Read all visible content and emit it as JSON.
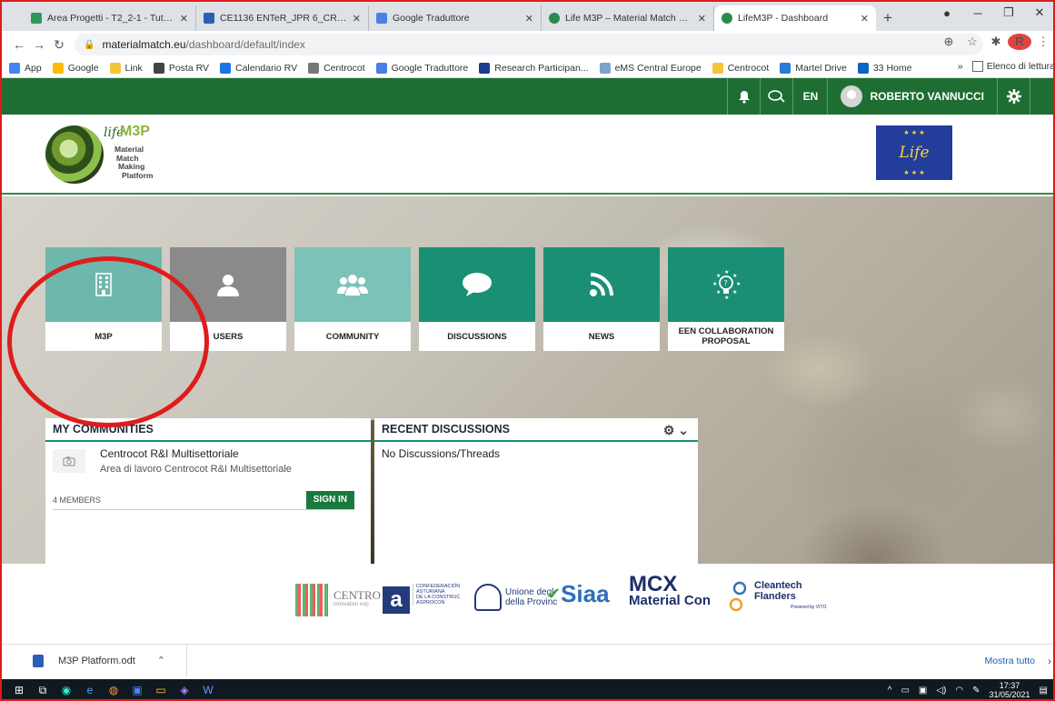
{
  "browser": {
    "tabs": [
      {
        "title": "Area Progetti - T2_2-1 - Tutti i do",
        "color": "#2f9a58"
      },
      {
        "title": "CE1136 ENTeR_JPR 6_CR1-Ver2.d",
        "color": "#2b5fb5"
      },
      {
        "title": "Google Traduttore",
        "color": "#4a7fe6"
      },
      {
        "title": "Life M3P – Material Match Makin",
        "color": "#2a8a4a"
      },
      {
        "title": "LifeM3P - Dashboard",
        "color": "#2a8a4a"
      }
    ],
    "new_tab": "+",
    "url_host": "materialmatch.eu",
    "url_path": "/dashboard/default/index",
    "profile_initial": "R",
    "bookmarks": [
      {
        "label": "App",
        "color": "#4285f4"
      },
      {
        "label": "Google",
        "color": "#fbbc05"
      },
      {
        "label": "Link",
        "color": "#f3c53a"
      },
      {
        "label": "Posta RV",
        "color": "#444444"
      },
      {
        "label": "Calendario RV",
        "color": "#1a73e8"
      },
      {
        "label": "Centrocot",
        "color": "#777777"
      },
      {
        "label": "Google Traduttore",
        "color": "#4a7fe6"
      },
      {
        "label": "Research Participan...",
        "color": "#1a3d8f"
      },
      {
        "label": "eMS Central Europe",
        "color": "#7fa3c7"
      },
      {
        "label": "Centrocot",
        "color": "#f3c53a"
      },
      {
        "label": "Martel Drive",
        "color": "#2a7bd3"
      },
      {
        "label": "33 Home",
        "color": "#0a66c2"
      }
    ],
    "reading_list": "Elenco di lettura",
    "more": "»"
  },
  "site": {
    "lang": "EN",
    "user_name": "ROBERTO VANNUCCI",
    "logo": {
      "life": "life",
      "m3p": "M3P",
      "lines": [
        "Material",
        "Match",
        "Making",
        "Platform"
      ]
    },
    "eu_logo_text": "Life"
  },
  "tiles": [
    {
      "label": "M3P",
      "icon": "building-icon"
    },
    {
      "label": "USERS",
      "icon": "user-icon"
    },
    {
      "label": "COMMUNITY",
      "icon": "group-icon"
    },
    {
      "label": "DISCUSSIONS",
      "icon": "speech-bubble-icon"
    },
    {
      "label": "NEWS",
      "icon": "rss-icon"
    },
    {
      "label": "EEN COLLABORATION PROPOSAL",
      "icon": "lightbulb-icon"
    }
  ],
  "my_communities": {
    "title": "MY COMMUNITIES",
    "item_title": "Centrocot R&I Multisettoriale",
    "item_sub": "Area di lavoro Centrocot R&I Multisettoriale",
    "members": "4 MEMBERS",
    "signin": "SIGN IN"
  },
  "recent_discussions": {
    "title": "RECENT DISCUSSIONS",
    "empty": "No Discussions/Threads"
  },
  "partners": {
    "centro": "CENTRO",
    "centro_sub": "innovation exp",
    "asturiana": [
      "CONFEDERACIÓN",
      "ASTURIANA",
      "DE LA CONSTRUC",
      "ASPROCON"
    ],
    "unione": [
      "Unione degl",
      "della Provinc"
    ],
    "siaa": "Siaa",
    "mcx": "MCX",
    "mcx_sub": "Material Con",
    "cleantech": [
      "Cleantech",
      "Flanders"
    ],
    "cleantech_sub": "Powered by VITO"
  },
  "downloads": {
    "file": "M3P Platform.odt",
    "show_all": "Mostra tutto"
  },
  "taskbar": {
    "time": "17:37",
    "date": "31/05/2021"
  }
}
